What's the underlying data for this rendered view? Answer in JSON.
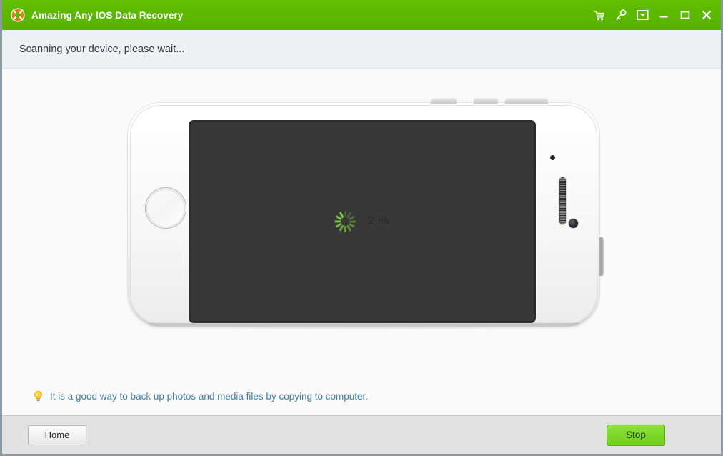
{
  "window": {
    "title": "Amazing Any IOS Data Recovery",
    "app_icon": "lifebuoy-icon",
    "titlebar_color": "#5cb800",
    "controls": [
      {
        "name": "cart-icon",
        "label": "Buy"
      },
      {
        "name": "key-icon",
        "label": "Register"
      },
      {
        "name": "dropdown-icon",
        "label": "Menu"
      },
      {
        "name": "minimize-icon",
        "label": "Minimize"
      },
      {
        "name": "maximize-icon",
        "label": "Maximize"
      },
      {
        "name": "close-icon",
        "label": "Close"
      }
    ]
  },
  "status": {
    "message": "Scanning your device, please wait..."
  },
  "device": {
    "type": "iphone-landscape",
    "screen_color": "#373737",
    "body_color": "#f5f5f5",
    "progress_percent": "2 %",
    "spinner": "loading-spinner",
    "spinner_color": "#7ac943"
  },
  "tip": {
    "icon": "lightbulb-icon",
    "text": "It is a good way to back up photos and media files by copying to computer.",
    "color": "#3f7fa8"
  },
  "footer": {
    "home_label": "Home",
    "stop_label": "Stop",
    "stop_color": "#7ed92a"
  }
}
